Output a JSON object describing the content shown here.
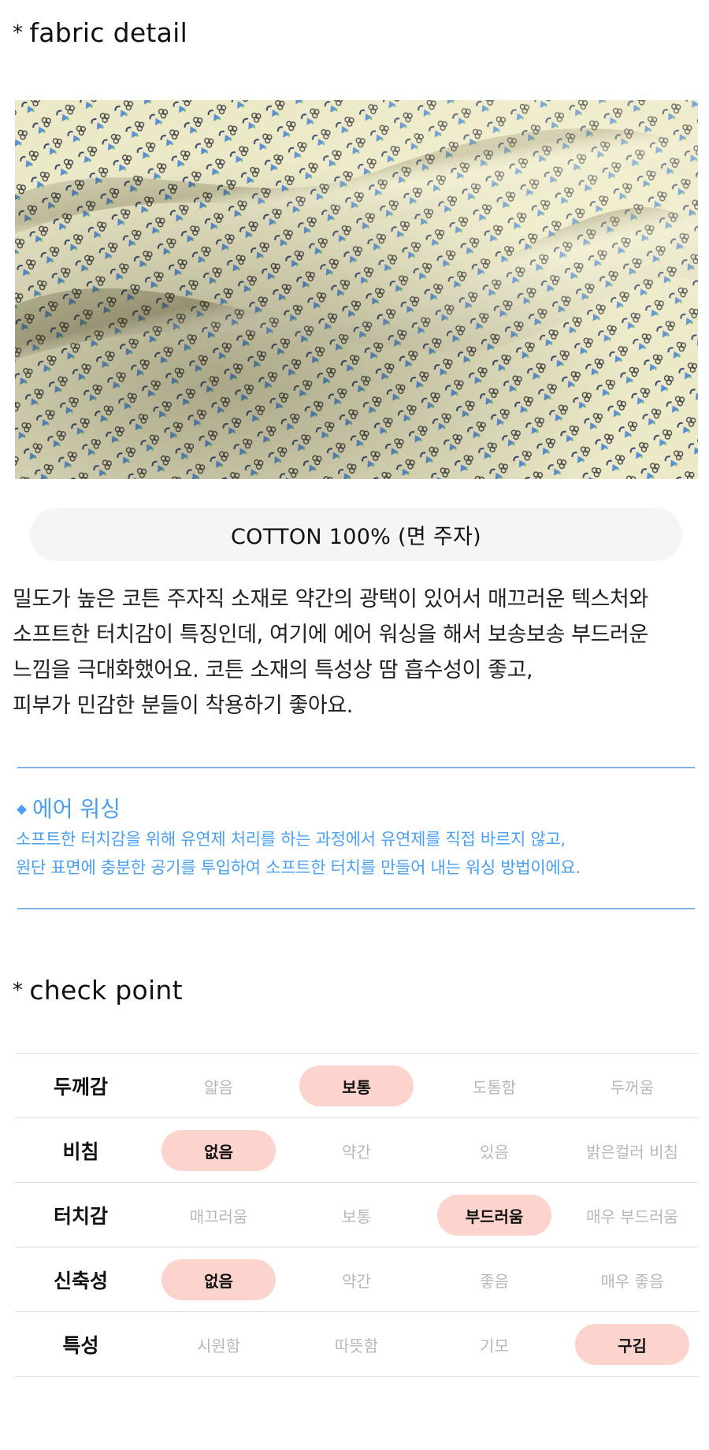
{
  "fabric": {
    "bullet": "*",
    "title": "fabric detail",
    "material": "COTTON 100% (면 주자)",
    "description": [
      "밀도가 높은 코튼 주자직 소재로 약간의 광택이 있어서 매끄러운 텍스처와",
      "소프트한 터치감이 특징인데, 여기에 에어 워싱을 해서 보송보송 부드러운",
      "느낌을 극대화했어요. 코튼 소재의 특성상 땀 흡수성이 좋고,",
      "피부가 민감한 분들이 착용하기 좋아요."
    ]
  },
  "note": {
    "title": "에어 워싱",
    "lines": [
      "소프트한 터치감을 위해 유연제 처리를 하는 과정에서 유연제를 직접 바르지 않고,",
      "원단 표면에 충분한 공기를 투입하여 소프트한 터치를 만들어 내는 워싱 방법이에요."
    ],
    "color": "#4a9ff0"
  },
  "check": {
    "bullet": "*",
    "title": "check point",
    "highlight_color": "#fdd4cd",
    "rows": [
      {
        "label": "두께감",
        "options": [
          "얇음",
          "보통",
          "도톰함",
          "두꺼움"
        ],
        "selected": 1
      },
      {
        "label": "비침",
        "options": [
          "없음",
          "약간",
          "있음",
          "밝은컬러 비침"
        ],
        "selected": 0
      },
      {
        "label": "터치감",
        "options": [
          "매끄러움",
          "보통",
          "부드러움",
          "매우 부드러움"
        ],
        "selected": 2
      },
      {
        "label": "신축성",
        "options": [
          "없음",
          "약간",
          "좋음",
          "매우 좋음"
        ],
        "selected": 0
      },
      {
        "label": "특성",
        "options": [
          "시원함",
          "따뜻함",
          "기모",
          "구김"
        ],
        "selected": 3
      }
    ]
  }
}
